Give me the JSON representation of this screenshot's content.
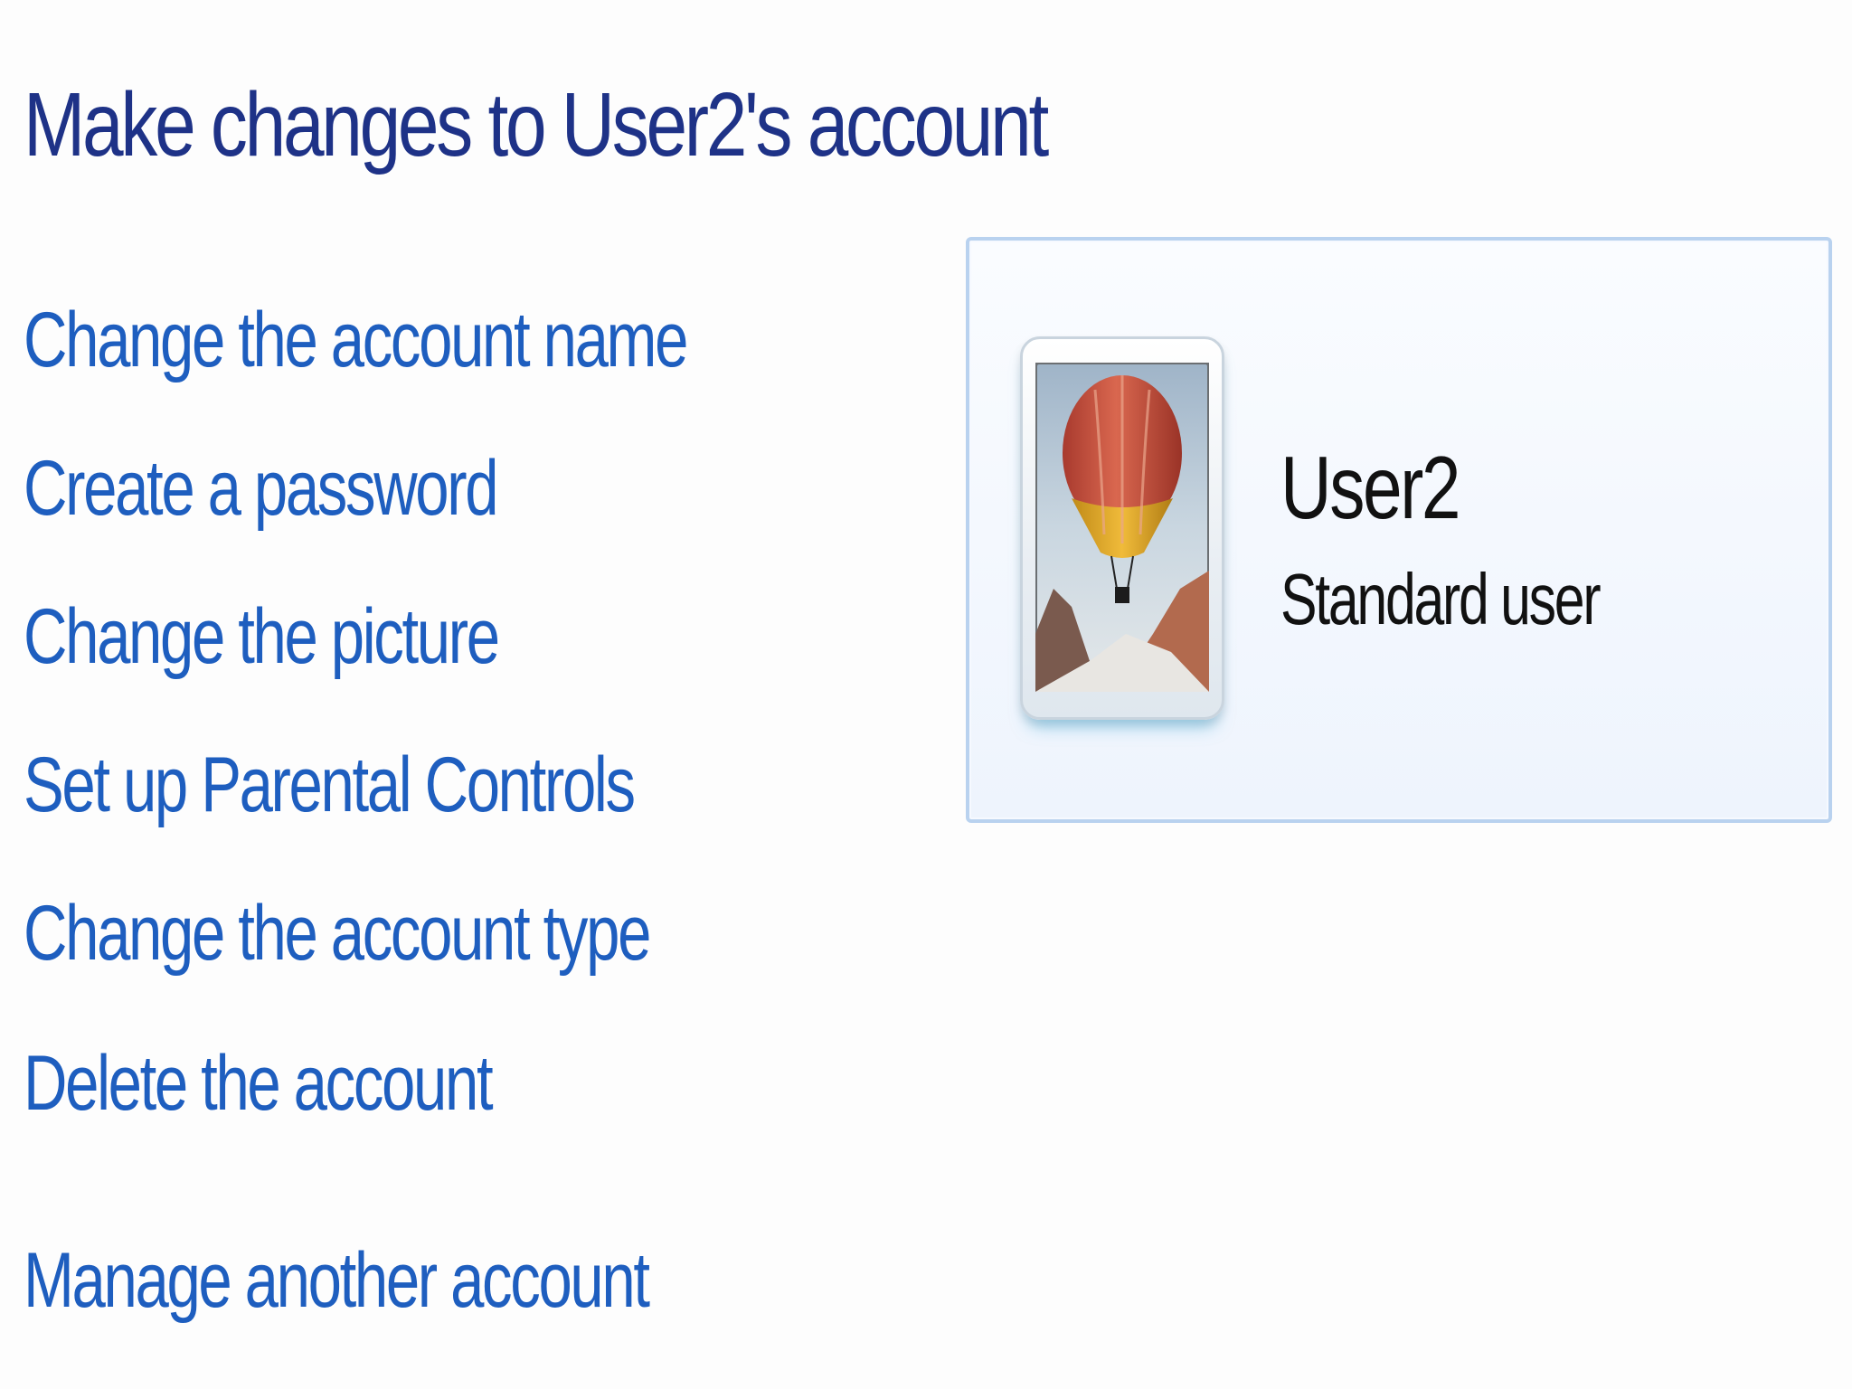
{
  "page": {
    "title": "Make changes to User2's account"
  },
  "tasks": [
    {
      "label": "Change the account name"
    },
    {
      "label": "Create a password"
    },
    {
      "label": "Change the picture"
    },
    {
      "label": "Set up Parental Controls"
    },
    {
      "label": "Change the account type"
    },
    {
      "label": "Delete the account"
    }
  ],
  "secondary_link": {
    "label": "Manage another account"
  },
  "account": {
    "name": "User2",
    "type": "Standard user",
    "picture_icon": "hot-air-balloon-icon"
  },
  "colors": {
    "title": "#1e3287",
    "link": "#1e5ebf",
    "card_border": "#b9d2ef",
    "text": "#111111"
  }
}
